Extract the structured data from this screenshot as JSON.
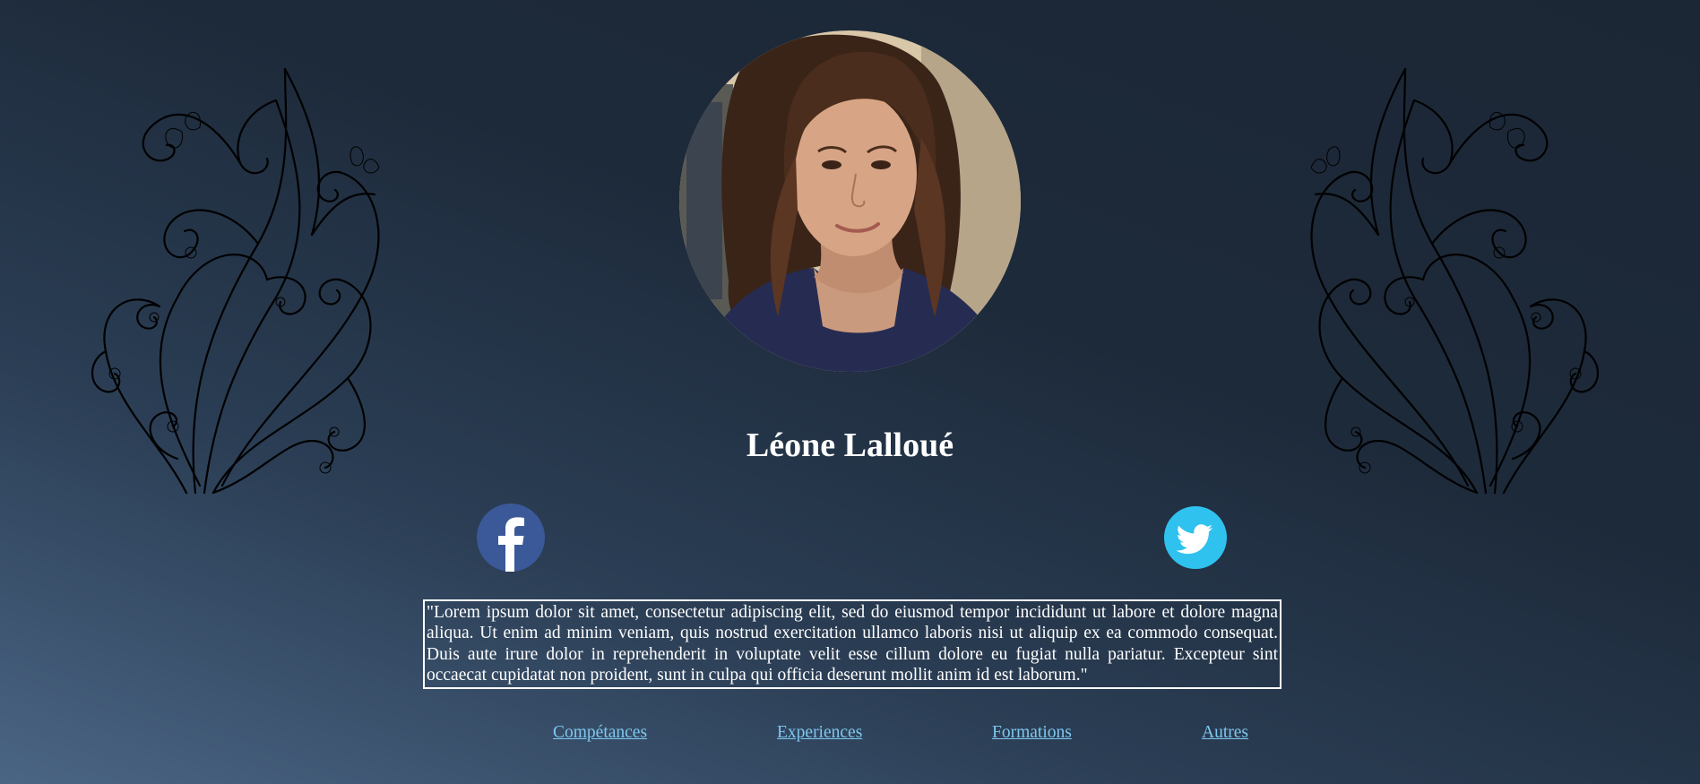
{
  "profile": {
    "name": "Léone Lalloué",
    "portrait_alt": "Portrait"
  },
  "social": {
    "facebook_icon": "facebook-icon",
    "twitter_icon": "twitter-icon",
    "facebook_color": "#3b5998",
    "twitter_color": "#2fc2ef"
  },
  "quote": "\"Lorem ipsum dolor sit amet, consectetur adipiscing elit, sed do eiusmod tempor incididunt ut labore et dolore magna aliqua. Ut enim ad minim veniam, quis nostrud exercitation ullamco laboris nisi ut aliquip ex ea commodo consequat. Duis aute irure dolor in reprehenderit in voluptate velit esse cillum dolore eu fugiat nulla pariatur. Excepteur sint occaecat cupidatat non proident, sunt in culpa qui officia deserunt mollit anim id est laborum.\"",
  "nav": {
    "items": [
      {
        "label": "Compétances"
      },
      {
        "label": "Experiences"
      },
      {
        "label": "Formations"
      },
      {
        "label": "Autres"
      }
    ]
  },
  "colors": {
    "link": "#7fc8f0",
    "background_dark": "#1c2735",
    "background_light": "#4a6584"
  }
}
